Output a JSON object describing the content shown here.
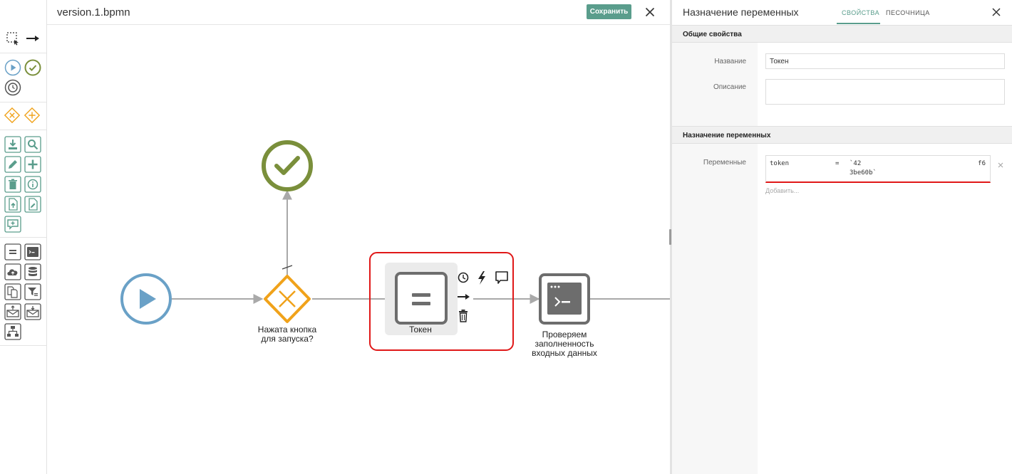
{
  "header": {
    "file_title": "version.1.bpmn",
    "save_label": "Сохранить"
  },
  "palette": {
    "groups": [
      {
        "tools": [
          "lasso-tool-icon",
          "connect-tool-icon"
        ]
      },
      {
        "tools": [
          "start-event-icon",
          "end-event-icon",
          "timer-event-icon"
        ]
      },
      {
        "tools": [
          "exclusive-gateway-icon",
          "parallel-gateway-icon"
        ]
      },
      {
        "tools": [
          "download-task-icon",
          "search-task-icon",
          "edit-task-icon",
          "add-task-icon",
          "delete-task-icon",
          "info-task-icon",
          "upload-file-icon",
          "edit-file-icon",
          "comment-task-icon"
        ]
      },
      {
        "tools": [
          "assign-variable-icon",
          "script-task-icon",
          "cloud-task-icon",
          "database-task-icon",
          "copy-task-icon",
          "filter-task-icon",
          "send-mail-icon",
          "receive-mail-icon",
          "subprocess-icon"
        ]
      }
    ]
  },
  "diagram": {
    "gateway_label": [
      "Нажата кнопка",
      "для запуска?"
    ],
    "task_token_label": "Токен",
    "task_check_label": [
      "Проверяем",
      "заполненность",
      "входных данных"
    ],
    "colors": {
      "start": "#6aa1c7",
      "end": "#7a8f3b",
      "gateway": "#f0a21a",
      "task_stroke": "#6d6d6d",
      "flow": "#a9a9a9",
      "selection": "#e01818"
    },
    "context_pad": [
      "timer-icon",
      "lightning-icon",
      "comment-icon",
      "arrow-icon",
      "trash-icon"
    ]
  },
  "panel": {
    "title": "Назначение переменных",
    "tabs": [
      "СВОЙСТВА",
      "ПЕСОЧНИЦА"
    ],
    "section_general": "Общие свойства",
    "name_label": "Название",
    "name_value": "Токен",
    "description_label": "Описание",
    "description_value": "",
    "section_vars": "Назначение переменных",
    "vars_label": "Переменные",
    "variable": {
      "name": "token",
      "operator": "=",
      "value_line1": "`42",
      "value_end": "f6",
      "value_line2": "3be60b`"
    },
    "add_label": "Добавить..."
  }
}
